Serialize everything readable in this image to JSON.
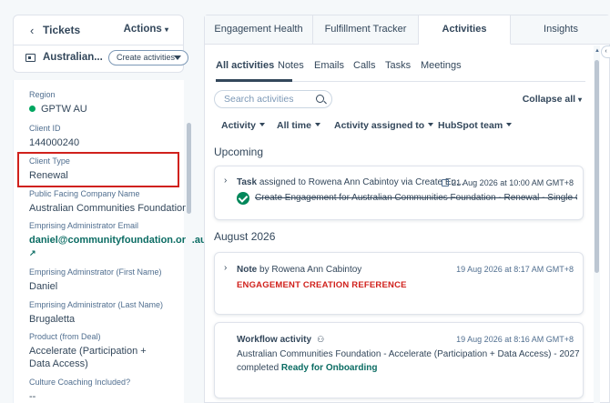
{
  "header": {
    "tickets_label": "Tickets",
    "actions_label": "Actions",
    "record_name": "Australian...",
    "create_activities_label": "Create activities"
  },
  "properties": [
    {
      "label": "Region",
      "value": "GPTW AU",
      "status_dot_color": "#00a660"
    },
    {
      "label": "Client ID",
      "value": "144000240"
    },
    {
      "label": "Client Type",
      "value": "Renewal"
    },
    {
      "label": "Public Facing Company Name",
      "value": "Australian Communities Foundation"
    },
    {
      "label": "Emprising Administrator Email",
      "value": "daniel@communityfoundation.org.au"
    },
    {
      "label": "Emprising Adminstrator (First Name)",
      "value": "Daniel"
    },
    {
      "label": "Emprising Administrator (Last Name)",
      "value": "Brugaletta"
    },
    {
      "label": "Product (from Deal)",
      "value": "Accelerate (Participation + Data Access)"
    },
    {
      "label": "Culture Coaching Included?",
      "value": "--"
    }
  ],
  "tabs": [
    {
      "label": "Engagement Health",
      "active": false
    },
    {
      "label": "Fulfillment Tracker",
      "active": false
    },
    {
      "label": "Activities",
      "active": true
    },
    {
      "label": "Insights",
      "active": false
    }
  ],
  "subtabs": [
    "All activities",
    "Notes",
    "Emails",
    "Calls",
    "Tasks",
    "Meetings"
  ],
  "search": {
    "placeholder": "Search activities"
  },
  "collapse_label": "Collapse all",
  "filters": [
    "Activity",
    "All time",
    "Activity assigned to",
    "HubSpot team"
  ],
  "sections": {
    "upcoming": "Upcoming",
    "august": "August 2026"
  },
  "task_card": {
    "type": "Task",
    "assigned_text": "assigned to Rowena Ann Cabintoy via Create En...",
    "date": "21 Aug 2026 at 10:00 AM GMT+8",
    "subject": "Create Engagement for Australian Communities Foundation - Renewal - Single C..."
  },
  "note_card": {
    "type": "Note",
    "by_text": "by Rowena Ann Cabintoy",
    "date": "19 Aug 2026 at 8:17 AM GMT+8",
    "body": "ENGAGEMENT CREATION REFERENCE"
  },
  "workflow_card": {
    "type": "Workflow activity",
    "date": "19 Aug 2026 at 8:16 AM GMT+8",
    "body": "Australian Communities Foundation - Accelerate (Participation + Data Access) - 2027 completed",
    "status": "Ready for Onboarding"
  },
  "colors": {
    "accent_teal": "#0b6c63",
    "highlight_red": "#d0211c",
    "success_green": "#00875a"
  }
}
